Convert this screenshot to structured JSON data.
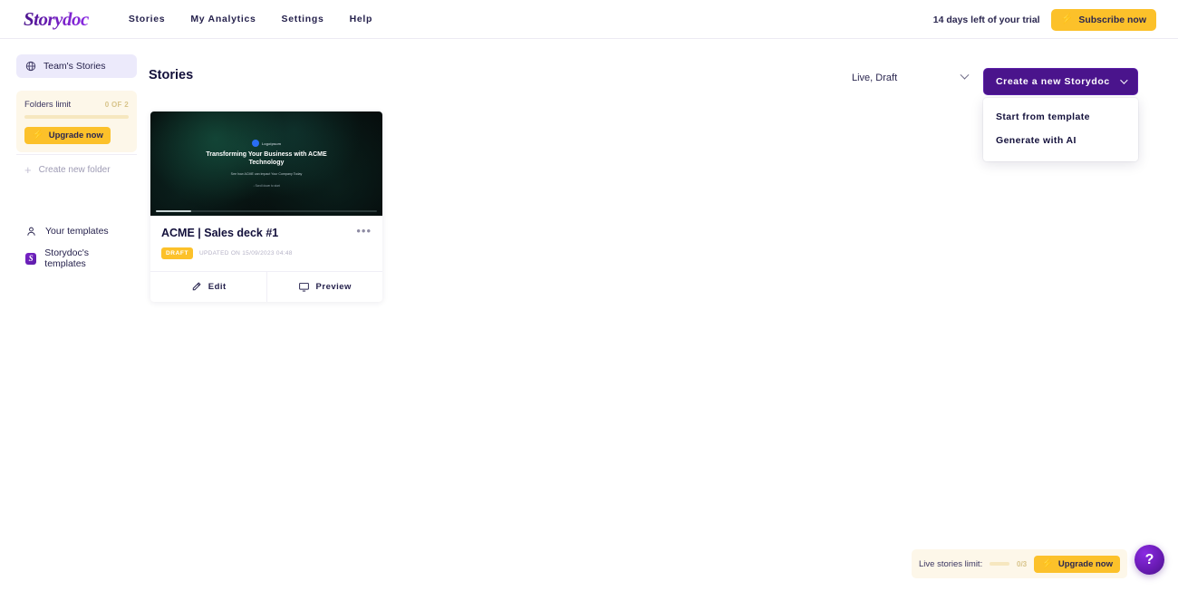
{
  "header": {
    "logo_text": "Storydoc",
    "nav": [
      {
        "label": "Stories"
      },
      {
        "label": "My Analytics"
      },
      {
        "label": "Settings"
      },
      {
        "label": "Help"
      }
    ],
    "trial_text": "14 days left of your trial",
    "subscribe_label": "Subscribe now",
    "bolt_glyph": "⚡"
  },
  "sidebar": {
    "team_stories": {
      "label": "Team's Stories",
      "icon": "globe-icon"
    },
    "folders": {
      "title": "Folders limit",
      "count": "0 OF 2",
      "progress_percent": 0,
      "upgrade_label": "Upgrade now"
    },
    "create_folder_label": "Create new folder",
    "links": [
      {
        "label": "Your templates",
        "icon": "person-icon"
      },
      {
        "label": "Storydoc's templates",
        "icon": "storydoc-badge-icon",
        "badge": "S"
      }
    ]
  },
  "main": {
    "page_title": "Stories",
    "filter": {
      "value": "Live, Draft"
    },
    "create_button": {
      "label": "Create a new Storydoc"
    },
    "dropdown": {
      "items": [
        {
          "label": "Start from template"
        },
        {
          "label": "Generate with AI"
        }
      ]
    },
    "card": {
      "title": "ACME | Sales deck #1",
      "status_badge": "DRAFT",
      "updated_text": "UPDATED ON 15/09/2023 04:48",
      "menu_glyph": "•••",
      "actions": [
        {
          "label": "Edit",
          "icon": "pencil-icon"
        },
        {
          "label": "Preview",
          "icon": "monitor-icon"
        }
      ],
      "thumbnail": {
        "logo_text": "Logoipsum",
        "title": "Transforming Your Business with ACME Technology",
        "subtitle": "See how ACME can impact Your Company Today",
        "cta": "↓ Scroll down to start"
      }
    }
  },
  "bottom": {
    "live_limit": {
      "label": "Live stories limit:",
      "count": "0/3",
      "progress_percent": 0,
      "upgrade_label": "Upgrade now"
    },
    "help_glyph": "?"
  },
  "colors": {
    "brand_purple": "#4a148c",
    "accent_yellow": "#fcc12a",
    "sidebar_active": "#eceafb",
    "warn_bg": "#fdf7e9"
  }
}
